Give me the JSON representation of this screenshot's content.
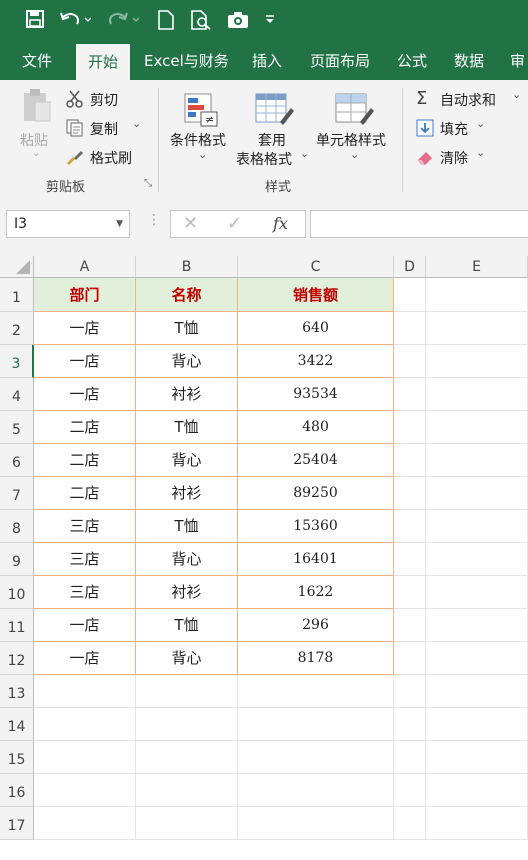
{
  "qat": {
    "save_icon": "save-icon",
    "undo_icon": "undo-icon",
    "redo_icon": "redo-icon",
    "new_icon": "new-file-icon",
    "preview_icon": "print-preview-icon",
    "camera_icon": "camera-icon",
    "customize_icon": "customize-qat-icon"
  },
  "tabs": [
    "文件",
    "开始",
    "Excel与财务",
    "插入",
    "页面布局",
    "公式",
    "数据",
    "审"
  ],
  "active_tab": "开始",
  "ribbon": {
    "clipboard": {
      "paste": "粘贴",
      "cut": "剪切",
      "copy": "复制",
      "format_painter": "格式刷",
      "group_label": "剪贴板"
    },
    "styles": {
      "conditional_format": "条件格式",
      "table_format_line1": "套用",
      "table_format_line2": "表格格式",
      "cell_styles": "单元格样式",
      "group_label": "样式"
    },
    "editing": {
      "autosum": "自动求和",
      "fill": "填充",
      "clear": "清除"
    }
  },
  "formula_bar": {
    "name_box": "I3",
    "fx": "fx",
    "content": ""
  },
  "columns": [
    "A",
    "B",
    "C",
    "D",
    "E"
  ],
  "rows": [
    "1",
    "2",
    "3",
    "4",
    "5",
    "6",
    "7",
    "8",
    "9",
    "10",
    "11",
    "12",
    "13",
    "14",
    "15",
    "16",
    "17"
  ],
  "table": {
    "headers": [
      "部门",
      "名称",
      "销售额"
    ],
    "rows": [
      [
        "一店",
        "T恤",
        "640"
      ],
      [
        "一店",
        "背心",
        "3422"
      ],
      [
        "一店",
        "衬衫",
        "93534"
      ],
      [
        "二店",
        "T恤",
        "480"
      ],
      [
        "二店",
        "背心",
        "25404"
      ],
      [
        "二店",
        "衬衫",
        "89250"
      ],
      [
        "三店",
        "T恤",
        "15360"
      ],
      [
        "三店",
        "背心",
        "16401"
      ],
      [
        "三店",
        "衬衫",
        "1622"
      ],
      [
        "一店",
        "T恤",
        "296"
      ],
      [
        "一店",
        "背心",
        "8178"
      ]
    ]
  },
  "colors": {
    "excel_green": "#217346",
    "header_fill": "#e2efda",
    "header_text": "#c00000",
    "border": "#f4b183"
  }
}
